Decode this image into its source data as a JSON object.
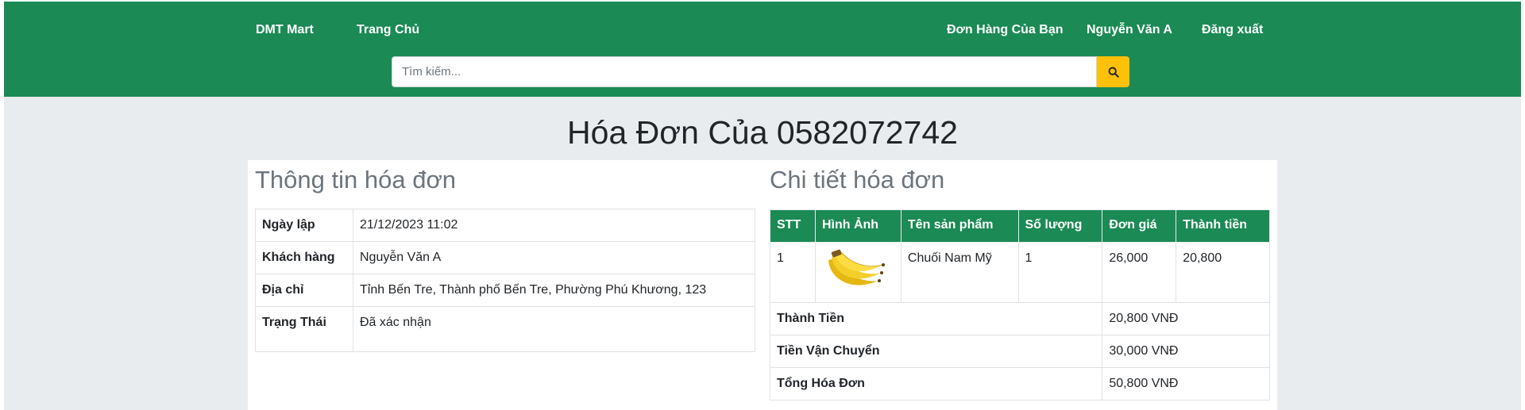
{
  "nav": {
    "brand": "DMT Mart",
    "home": "Trang Chủ",
    "orders": "Đơn Hàng Của Bạn",
    "user": "Nguyễn Văn A",
    "logout": "Đăng xuất"
  },
  "search": {
    "placeholder": "Tìm kiếm..."
  },
  "page": {
    "title": "Hóa Đơn Của 0582072742"
  },
  "info": {
    "title": "Thông tin hóa đơn",
    "rows": [
      {
        "label": "Ngày lập",
        "value": "21/12/2023 11:02"
      },
      {
        "label": "Khách hàng",
        "value": "Nguyễn Văn A"
      },
      {
        "label": "Địa chỉ",
        "value": "Tỉnh Bến Tre, Thành phố Bến Tre, Phường Phú Khương, 123"
      },
      {
        "label": "Trạng Thái",
        "value": "Đã xác nhận"
      }
    ]
  },
  "detail": {
    "title": "Chi tiết hóa đơn",
    "headers": [
      "STT",
      "Hình Ảnh",
      "Tên sản phẩm",
      "Số lượng",
      "Đơn giá",
      "Thành tiền"
    ],
    "items": [
      {
        "stt": "1",
        "image": "banana-image",
        "name": "Chuối Nam Mỹ",
        "qty": "1",
        "price": "26,000",
        "total": "20,800"
      }
    ],
    "summary": [
      {
        "label": "Thành Tiền",
        "value": "20,800 VNĐ"
      },
      {
        "label": "Tiền Vận Chuyển",
        "value": "30,000 VNĐ"
      },
      {
        "label": "Tổng Hóa Đơn",
        "value": "50,800 VNĐ"
      }
    ]
  },
  "colors": {
    "primary": "#1b8a55",
    "search_button": "#ffc107",
    "background": "#e9ecef"
  },
  "icons": {
    "search_button": "search-icon"
  }
}
